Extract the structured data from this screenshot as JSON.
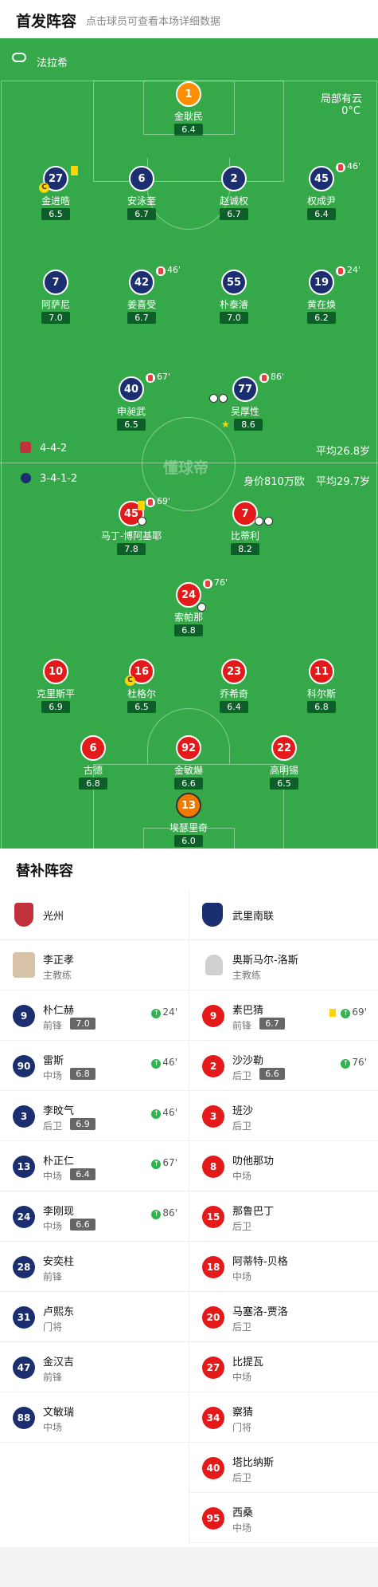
{
  "header": {
    "title": "首发阵容",
    "subtitle": "点击球员可查看本场详细数据"
  },
  "pitch": {
    "referee": "法拉希",
    "weather": "局部有云",
    "temp": "0°C",
    "watermark": "懂球帝",
    "home_formation": "4-4-2",
    "home_avg_age": "平均26.8岁",
    "away_formation": "3-4-1-2",
    "away_value": "身价810万欧",
    "away_avg_age": "平均29.7岁",
    "players": [
      {
        "num": "1",
        "name": "金耿民",
        "rating": "6.4",
        "color": "gk-home"
      },
      {
        "num": "27",
        "name": "金进晧",
        "rating": "6.5",
        "color": "navy",
        "captain": "C",
        "card": "yellow"
      },
      {
        "num": "6",
        "name": "安泳奎",
        "rating": "6.7",
        "color": "navy"
      },
      {
        "num": "2",
        "name": "赵诚权",
        "rating": "6.7",
        "color": "navy"
      },
      {
        "num": "45",
        "name": "权成尹",
        "rating": "6.4",
        "color": "navy",
        "sub": "46'"
      },
      {
        "num": "7",
        "name": "阿萨尼",
        "rating": "7.0",
        "color": "navy"
      },
      {
        "num": "42",
        "name": "姜喜受",
        "rating": "6.7",
        "color": "navy",
        "sub": "46'"
      },
      {
        "num": "55",
        "name": "朴泰濬",
        "rating": "7.0",
        "color": "navy"
      },
      {
        "num": "19",
        "name": "黄在焕",
        "rating": "6.2",
        "color": "navy",
        "sub": "24'"
      },
      {
        "num": "40",
        "name": "申昶武",
        "rating": "6.5",
        "color": "navy",
        "sub": "67'"
      },
      {
        "num": "77",
        "name": "吴厚性",
        "rating": "8.6",
        "color": "navy",
        "sub": "86'",
        "mvp": "★"
      },
      {
        "num": "45",
        "name": "马丁-博阿基耶",
        "rating": "7.8",
        "color": "red",
        "sub": "69'",
        "card": "yellow"
      },
      {
        "num": "7",
        "name": "比蒂利",
        "rating": "8.2",
        "color": "red"
      },
      {
        "num": "24",
        "name": "索帕那",
        "rating": "6.8",
        "color": "red",
        "sub": "76'"
      },
      {
        "num": "10",
        "name": "克里斯平",
        "rating": "6.9",
        "color": "red"
      },
      {
        "num": "16",
        "name": "杜格尔",
        "rating": "6.5",
        "color": "red",
        "captain": "C"
      },
      {
        "num": "23",
        "name": "乔希奇",
        "rating": "6.4",
        "color": "red"
      },
      {
        "num": "11",
        "name": "科尔斯",
        "rating": "6.8",
        "color": "red"
      },
      {
        "num": "6",
        "name": "古德",
        "rating": "6.8",
        "color": "red"
      },
      {
        "num": "92",
        "name": "金敏爀",
        "rating": "6.6",
        "color": "red"
      },
      {
        "num": "22",
        "name": "高明锡",
        "rating": "6.5",
        "color": "red"
      },
      {
        "num": "13",
        "name": "埃瑟里奇",
        "rating": "6.0",
        "color": "gk-away"
      }
    ]
  },
  "subs": {
    "title": "替补阵容",
    "home": {
      "team": "光州",
      "coach_name": "李正孝",
      "coach_role": "主教练",
      "players": [
        {
          "num": "9",
          "name": "朴仁赫",
          "pos": "前锋",
          "rating": "7.0",
          "sub": "24'"
        },
        {
          "num": "90",
          "name": "雷斯",
          "pos": "中场",
          "rating": "6.8",
          "sub": "46'"
        },
        {
          "num": "3",
          "name": "李旼气",
          "pos": "后卫",
          "rating": "6.9",
          "sub": "46'"
        },
        {
          "num": "13",
          "name": "朴正仁",
          "pos": "中场",
          "rating": "6.4",
          "sub": "67'"
        },
        {
          "num": "24",
          "name": "李刚现",
          "pos": "中场",
          "rating": "6.6",
          "sub": "86'"
        },
        {
          "num": "28",
          "name": "安奕柱",
          "pos": "前锋"
        },
        {
          "num": "31",
          "name": "卢熙东",
          "pos": "门将"
        },
        {
          "num": "47",
          "name": "金汉吉",
          "pos": "前锋"
        },
        {
          "num": "88",
          "name": "文敏瑞",
          "pos": "中场"
        }
      ]
    },
    "away": {
      "team": "武里南联",
      "coach_name": "奥斯马尔-洛斯",
      "coach_role": "主教练",
      "players": [
        {
          "num": "9",
          "name": "素巴猜",
          "pos": "前锋",
          "rating": "6.7",
          "sub": "69'",
          "card": "yellow"
        },
        {
          "num": "2",
          "name": "沙沙勒",
          "pos": "后卫",
          "rating": "6.6",
          "sub": "76'"
        },
        {
          "num": "3",
          "name": "班沙",
          "pos": "后卫"
        },
        {
          "num": "8",
          "name": "叻他那功",
          "pos": "中场"
        },
        {
          "num": "15",
          "name": "那鲁巴丁",
          "pos": "后卫"
        },
        {
          "num": "18",
          "name": "阿蒂特-贝格",
          "pos": "中场"
        },
        {
          "num": "20",
          "name": "马塞洛-贾洛",
          "pos": "后卫"
        },
        {
          "num": "27",
          "name": "比提瓦",
          "pos": "中场"
        },
        {
          "num": "34",
          "name": "察猜",
          "pos": "门将"
        },
        {
          "num": "40",
          "name": "塔比纳斯",
          "pos": "后卫"
        },
        {
          "num": "95",
          "name": "西桑",
          "pos": "中场"
        }
      ]
    }
  }
}
